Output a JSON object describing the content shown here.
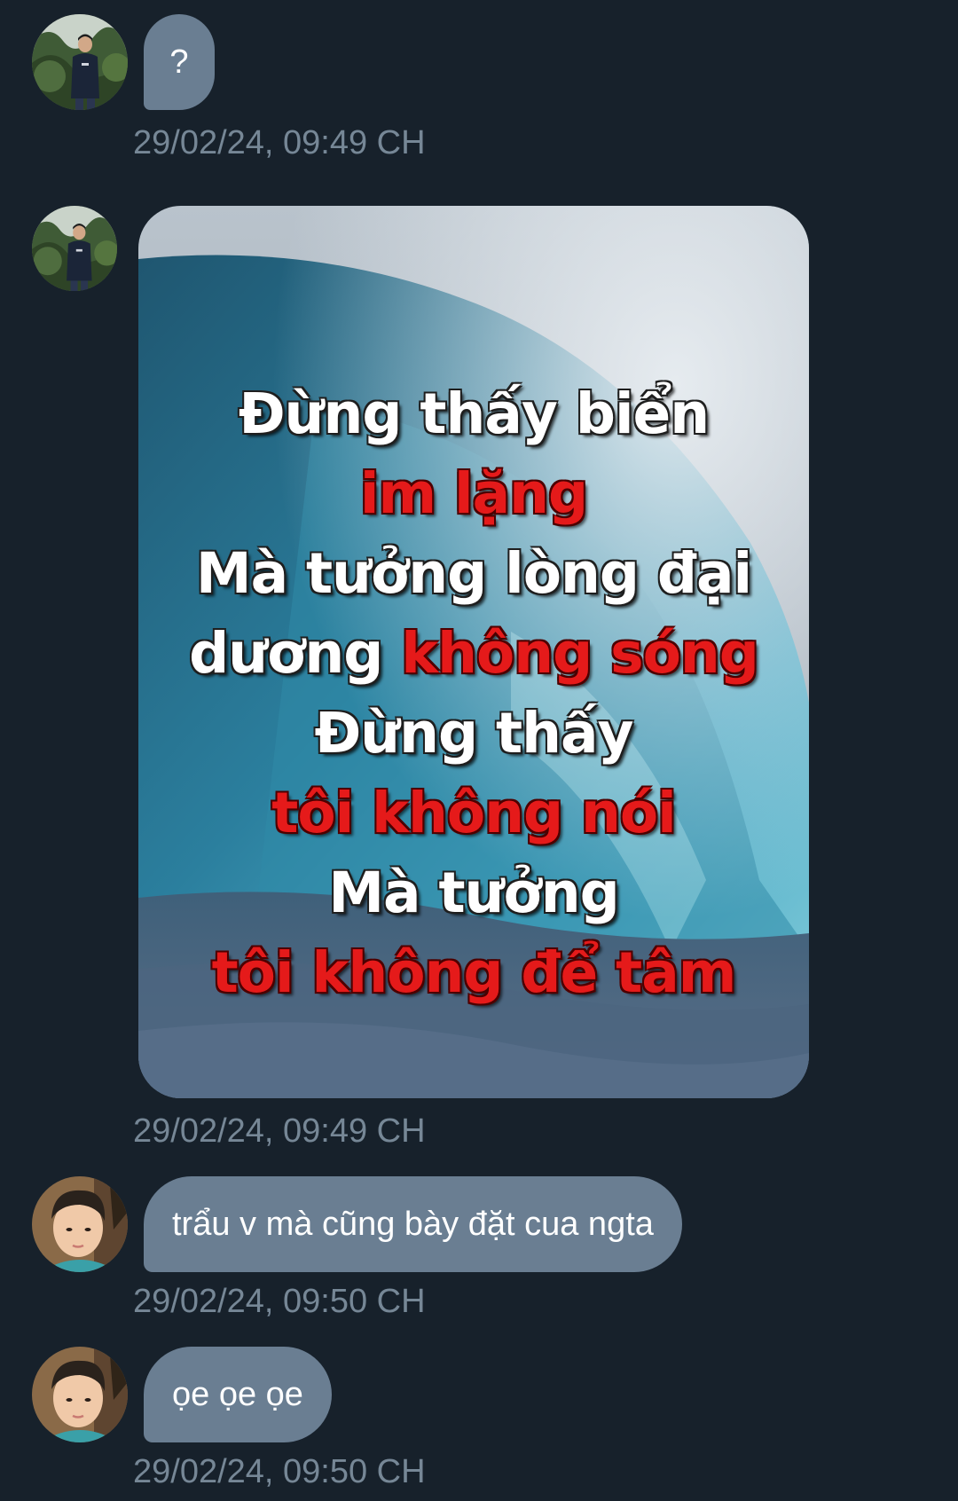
{
  "messages": [
    {
      "type": "text",
      "sender": "user-a",
      "text": "?",
      "time": "29/02/24, 09:49 CH"
    },
    {
      "type": "image",
      "sender": "user-a",
      "time": "29/02/24, 09:49 CH"
    },
    {
      "type": "text",
      "sender": "user-b",
      "text": "trẩu v mà cũng bày đặt cua ngta",
      "time": "29/02/24, 09:50 CH"
    },
    {
      "type": "text",
      "sender": "user-b",
      "text": "ọe ọe ọe",
      "time": "29/02/24, 09:50 CH"
    }
  ],
  "image_text": {
    "line1": "Đừng thấy biển",
    "line2": "im lặng",
    "line3": "Mà tưởng lòng đại",
    "line4a": "dương ",
    "line4b": "không sóng",
    "line5": "Đừng thấy",
    "line6": "tôi không nói",
    "line7": "Mà tưởng",
    "line8": "tôi không để tâm"
  },
  "colors": {
    "background": "#17212b",
    "bubble": "#6a7e92",
    "timestamp": "#768796",
    "poem_white": "#ffffff",
    "poem_red": "#e51a1a"
  },
  "icons": {
    "avatar_a": "user-avatar-forest",
    "avatar_b": "user-avatar-face"
  }
}
